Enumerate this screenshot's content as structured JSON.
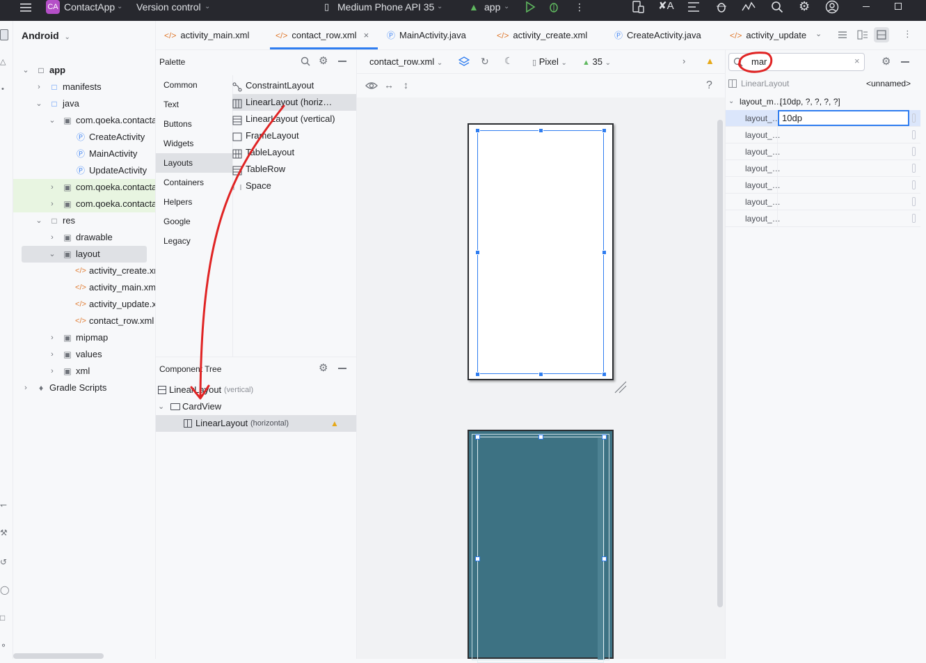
{
  "titlebar": {
    "app_badge": "CA",
    "project_name": "ContactApp",
    "vcs": "Version control",
    "device": "Medium Phone API 35",
    "run_config": "app"
  },
  "project_panel": {
    "view_mode": "Android",
    "items": [
      {
        "label": "app",
        "icon": "module"
      },
      {
        "label": "manifests",
        "icon": "folder"
      },
      {
        "label": "java",
        "icon": "folder"
      },
      {
        "label": "com.qoeka.contacta",
        "icon": "package"
      },
      {
        "label": "CreateActivity",
        "icon": "class"
      },
      {
        "label": "MainActivity",
        "icon": "class"
      },
      {
        "label": "UpdateActivity",
        "icon": "class"
      },
      {
        "label": "com.qoeka.contacta",
        "icon": "package"
      },
      {
        "label": "com.qoeka.contacta",
        "icon": "package"
      },
      {
        "label": "res",
        "icon": "res-folder"
      },
      {
        "label": "drawable",
        "icon": "package"
      },
      {
        "label": "layout",
        "icon": "package"
      },
      {
        "label": "activity_create.xm",
        "icon": "xml"
      },
      {
        "label": "activity_main.xm",
        "icon": "xml"
      },
      {
        "label": "activity_update.x",
        "icon": "xml"
      },
      {
        "label": "contact_row.xml",
        "icon": "xml"
      },
      {
        "label": "mipmap",
        "icon": "package"
      },
      {
        "label": "values",
        "icon": "package"
      },
      {
        "label": "xml",
        "icon": "package"
      },
      {
        "label": "Gradle Scripts",
        "icon": "gradle"
      }
    ]
  },
  "tabs": [
    {
      "label": "activity_main.xml",
      "type": "xml"
    },
    {
      "label": "contact_row.xml",
      "type": "xml",
      "active": true
    },
    {
      "label": "MainActivity.java",
      "type": "java"
    },
    {
      "label": "activity_create.xml",
      "type": "xml"
    },
    {
      "label": "CreateActivity.java",
      "type": "java"
    },
    {
      "label": "activity_update",
      "type": "xml"
    }
  ],
  "palette": {
    "title": "Palette",
    "categories": [
      "Common",
      "Text",
      "Buttons",
      "Widgets",
      "Layouts",
      "Containers",
      "Helpers",
      "Google",
      "Legacy"
    ],
    "selected_category": "Layouts",
    "items": [
      {
        "label": "ConstraintLayout",
        "icon": "constraint-icon"
      },
      {
        "label": "LinearLayout (horiz…",
        "icon": "linear-horizontal-icon"
      },
      {
        "label": "LinearLayout (vertical)",
        "icon": "linear-vertical-icon"
      },
      {
        "label": "FrameLayout",
        "icon": "frame-icon"
      },
      {
        "label": "TableLayout",
        "icon": "table-icon"
      },
      {
        "label": "TableRow",
        "icon": "tablerow-icon"
      },
      {
        "label": "Space",
        "icon": "space-icon"
      }
    ]
  },
  "component_tree": {
    "title": "Component Tree",
    "nodes": [
      {
        "label": "LinearLayout",
        "hint": "(vertical)"
      },
      {
        "label": "CardView",
        "hint": ""
      },
      {
        "label": "LinearLayout",
        "hint": "(horizontal)"
      }
    ]
  },
  "design_toolbar": {
    "file": "contact_row.xml",
    "device": "Pixel",
    "api": "35",
    "help": "?"
  },
  "attributes": {
    "search_value": "mar",
    "component": "LinearLayout",
    "component_id": "<unnamed>",
    "group_label": "layout_m…",
    "group_value": "[10dp, ?, ?, ?, ?]",
    "rows": [
      {
        "label": "layout_…",
        "value": "10dp"
      },
      {
        "label": "layout_…",
        "value": ""
      },
      {
        "label": "layout_…",
        "value": ""
      },
      {
        "label": "layout_…",
        "value": ""
      },
      {
        "label": "layout_…",
        "value": ""
      },
      {
        "label": "layout_…",
        "value": ""
      },
      {
        "label": "layout_…",
        "value": ""
      }
    ]
  },
  "colors": {
    "accent": "#2f7df0",
    "annotation": "#e02424",
    "blueprint": "#3d7283",
    "titlebar": "#27282e"
  }
}
